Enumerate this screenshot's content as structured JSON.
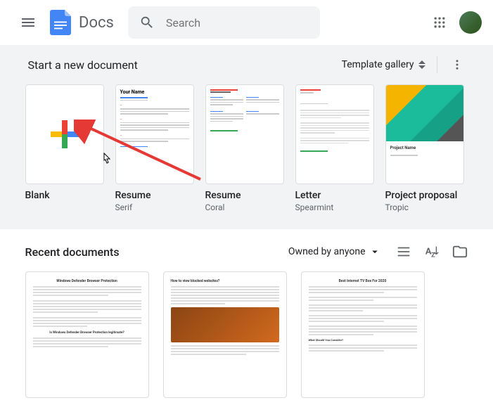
{
  "header": {
    "app_name": "Docs",
    "search_placeholder": "Search"
  },
  "templates": {
    "section_title": "Start a new document",
    "gallery_label": "Template gallery",
    "items": [
      {
        "name": "Blank",
        "sub": ""
      },
      {
        "name": "Resume",
        "sub": "Serif"
      },
      {
        "name": "Resume",
        "sub": "Coral"
      },
      {
        "name": "Letter",
        "sub": "Spearmint"
      },
      {
        "name": "Project proposal",
        "sub": "Tropic"
      }
    ]
  },
  "recent": {
    "section_title": "Recent documents",
    "owner_filter": "Owned by anyone"
  },
  "thumbs": {
    "resume_name": "Your Name",
    "proposal_title": "Project Name"
  }
}
